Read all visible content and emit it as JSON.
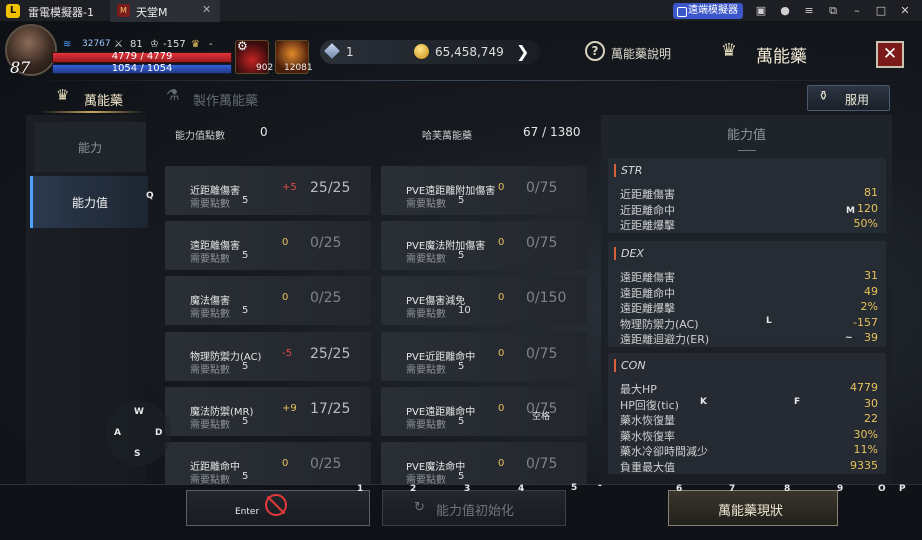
{
  "emulator": {
    "app_name": "雷電模擬器-1",
    "tab_title": "天堂M",
    "tab_close": "✕",
    "remote_label": "遠端模擬器",
    "window_icons": [
      "gift-icon",
      "user-icon",
      "menu-icon",
      "restore-icon",
      "minimize-icon",
      "maximize-icon",
      "close-icon"
    ]
  },
  "hud": {
    "level": "87",
    "power": "32767",
    "attack": "81",
    "lawful": "-157",
    "trophy": "-",
    "hp": "4779 / 4779",
    "mp": "1054 / 1054",
    "potion_count": "902",
    "scroll_count": "12081",
    "crystal": "1",
    "gold": "65,458,749",
    "help_label": "萬能藥說明",
    "title": "萬能藥",
    "close": "✕"
  },
  "tabs": {
    "potion": "萬能藥",
    "craft": "製作萬能藥",
    "use_button": "服用"
  },
  "side_menu": {
    "ability": "能力",
    "stat": "能力值"
  },
  "header": {
    "stat_points_label": "能力值點數",
    "stat_points_value": "0",
    "hafon_label": "哈芙萬能藥",
    "hafon_value": "67 / 1380"
  },
  "cards": [
    {
      "name": "近距離傷害",
      "req_label": "需要點數",
      "req": "5",
      "bonus": "+5",
      "bonus_color": "red",
      "progress": "25/25",
      "full": true
    },
    {
      "name": "PVE遠距離附加傷害",
      "req_label": "需要點數",
      "req": "5",
      "bonus": "0",
      "bonus_color": "gold",
      "progress": "0/75",
      "full": false
    },
    {
      "name": "遠距離傷害",
      "req_label": "需要點數",
      "req": "5",
      "bonus": "0",
      "bonus_color": "gold",
      "progress": "0/25",
      "full": false
    },
    {
      "name": "PVE魔法附加傷害",
      "req_label": "需要點數",
      "req": "5",
      "bonus": "0",
      "bonus_color": "gold",
      "progress": "0/75",
      "full": false
    },
    {
      "name": "魔法傷害",
      "req_label": "需要點數",
      "req": "5",
      "bonus": "0",
      "bonus_color": "gold",
      "progress": "0/25",
      "full": false
    },
    {
      "name": "PVE傷害減免",
      "req_label": "需要點數",
      "req": "10",
      "bonus": "0",
      "bonus_color": "gold",
      "progress": "0/150",
      "full": false
    },
    {
      "name": "物理防禦力(AC)",
      "req_label": "需要點數",
      "req": "5",
      "bonus": "-5",
      "bonus_color": "red",
      "progress": "25/25",
      "full": true
    },
    {
      "name": "PVE近距離命中",
      "req_label": "需要點數",
      "req": "5",
      "bonus": "0",
      "bonus_color": "gold",
      "progress": "0/75",
      "full": false
    },
    {
      "name": "魔法防禦(MR)",
      "req_label": "需要點數",
      "req": "5",
      "bonus": "+9",
      "bonus_color": "gold",
      "progress": "17/25",
      "full": true
    },
    {
      "name": "PVE遠距離命中",
      "req_label": "需要點數",
      "req": "5",
      "bonus": "0",
      "bonus_color": "gold",
      "progress": "0/75",
      "full": false
    },
    {
      "name": "近距離命中",
      "req_label": "需要點數",
      "req": "5",
      "bonus": "0",
      "bonus_color": "gold",
      "progress": "0/25",
      "full": false
    },
    {
      "name": "PVE魔法命中",
      "req_label": "需要點數",
      "req": "5",
      "bonus": "0",
      "bonus_color": "gold",
      "progress": "0/75",
      "full": false
    }
  ],
  "stat_panel": {
    "title": "能力值",
    "sections": [
      {
        "name": "STR",
        "rows": [
          {
            "label": "近距離傷害",
            "value": "81"
          },
          {
            "label": "近距離命中",
            "value": "120"
          },
          {
            "label": "近距離爆擊",
            "value": "50%"
          }
        ]
      },
      {
        "name": "DEX",
        "rows": [
          {
            "label": "遠距離傷害",
            "value": "31"
          },
          {
            "label": "遠距離命中",
            "value": "49"
          },
          {
            "label": "遠距離爆擊",
            "value": "2%"
          },
          {
            "label": "物理防禦力(AC)",
            "value": "-157"
          },
          {
            "label": "遠距離迴避力(ER)",
            "value": "39"
          }
        ]
      },
      {
        "name": "CON",
        "rows": [
          {
            "label": "最大HP",
            "value": "4779"
          },
          {
            "label": "HP回復(tic)",
            "value": "30"
          },
          {
            "label": "藥水恢復量",
            "value": "22"
          },
          {
            "label": "藥水恢復率",
            "value": "30%"
          },
          {
            "label": "藥水冷卻時間減少",
            "value": "11%"
          },
          {
            "label": "負重最大值",
            "value": "9335"
          }
        ]
      }
    ]
  },
  "bottom": {
    "reset": "能力值初始化",
    "status": "萬能藥現狀",
    "enter_key": "Enter"
  },
  "key_hints": {
    "Q": "Q",
    "M": "M",
    "L": "L",
    "tilde": "~",
    "K": "K",
    "F": "F",
    "space": "空格",
    "W": "W",
    "A": "A",
    "S": "S",
    "D": "D",
    "n1": "1",
    "n2": "2",
    "n3": "3",
    "n4": "4",
    "n5": "5",
    "minus": "-",
    "n6": "6",
    "n7": "7",
    "n8": "8",
    "n9": "9",
    "O": "O",
    "P": "P"
  }
}
